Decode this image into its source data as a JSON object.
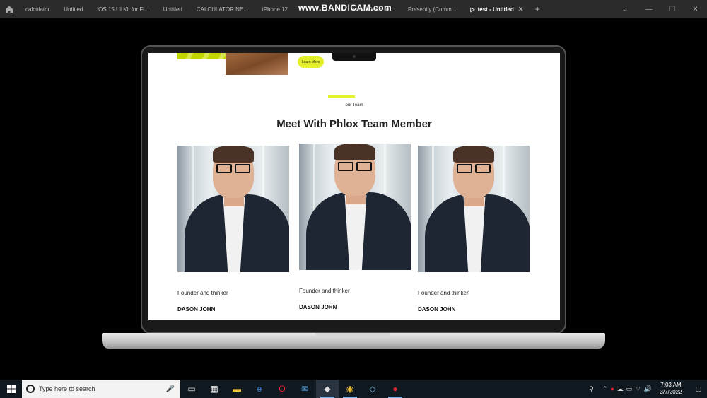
{
  "browser": {
    "tabs": [
      {
        "label": "calculator"
      },
      {
        "label": "Untitled"
      },
      {
        "label": "iOS 15 UI Kit for Fi..."
      },
      {
        "label": "Untitled"
      },
      {
        "label": "CALCULATOR NE..."
      },
      {
        "label": "iPhone 12"
      },
      {
        "label": "use of David te..."
      },
      {
        "label": "Presently (Comm..."
      }
    ],
    "active_tab": "test - Untitled",
    "watermark": "www.BANDICAM.com"
  },
  "page": {
    "learn_more_label": "Learn More",
    "eyebrow": "our Team",
    "heading": "Meet With Phlox Team Member",
    "accent_color": "#e3f02a",
    "members": [
      {
        "role": "Founder and thinker",
        "name": "DASON JOHN"
      },
      {
        "role": "Founder and thinker",
        "name": "DASON JOHN"
      },
      {
        "role": "Founder and thinker",
        "name": "DASON JOHN"
      }
    ]
  },
  "taskbar": {
    "search_placeholder": "Type here to search",
    "time": "7:03 AM",
    "date": "3/7/2022",
    "apps": [
      "task-view-icon",
      "store-icon",
      "file-explorer-icon",
      "edge-icon",
      "opera-icon",
      "mail-icon",
      "figma-icon",
      "chrome-icon",
      "app-icon",
      "bandicam-record-icon"
    ]
  }
}
